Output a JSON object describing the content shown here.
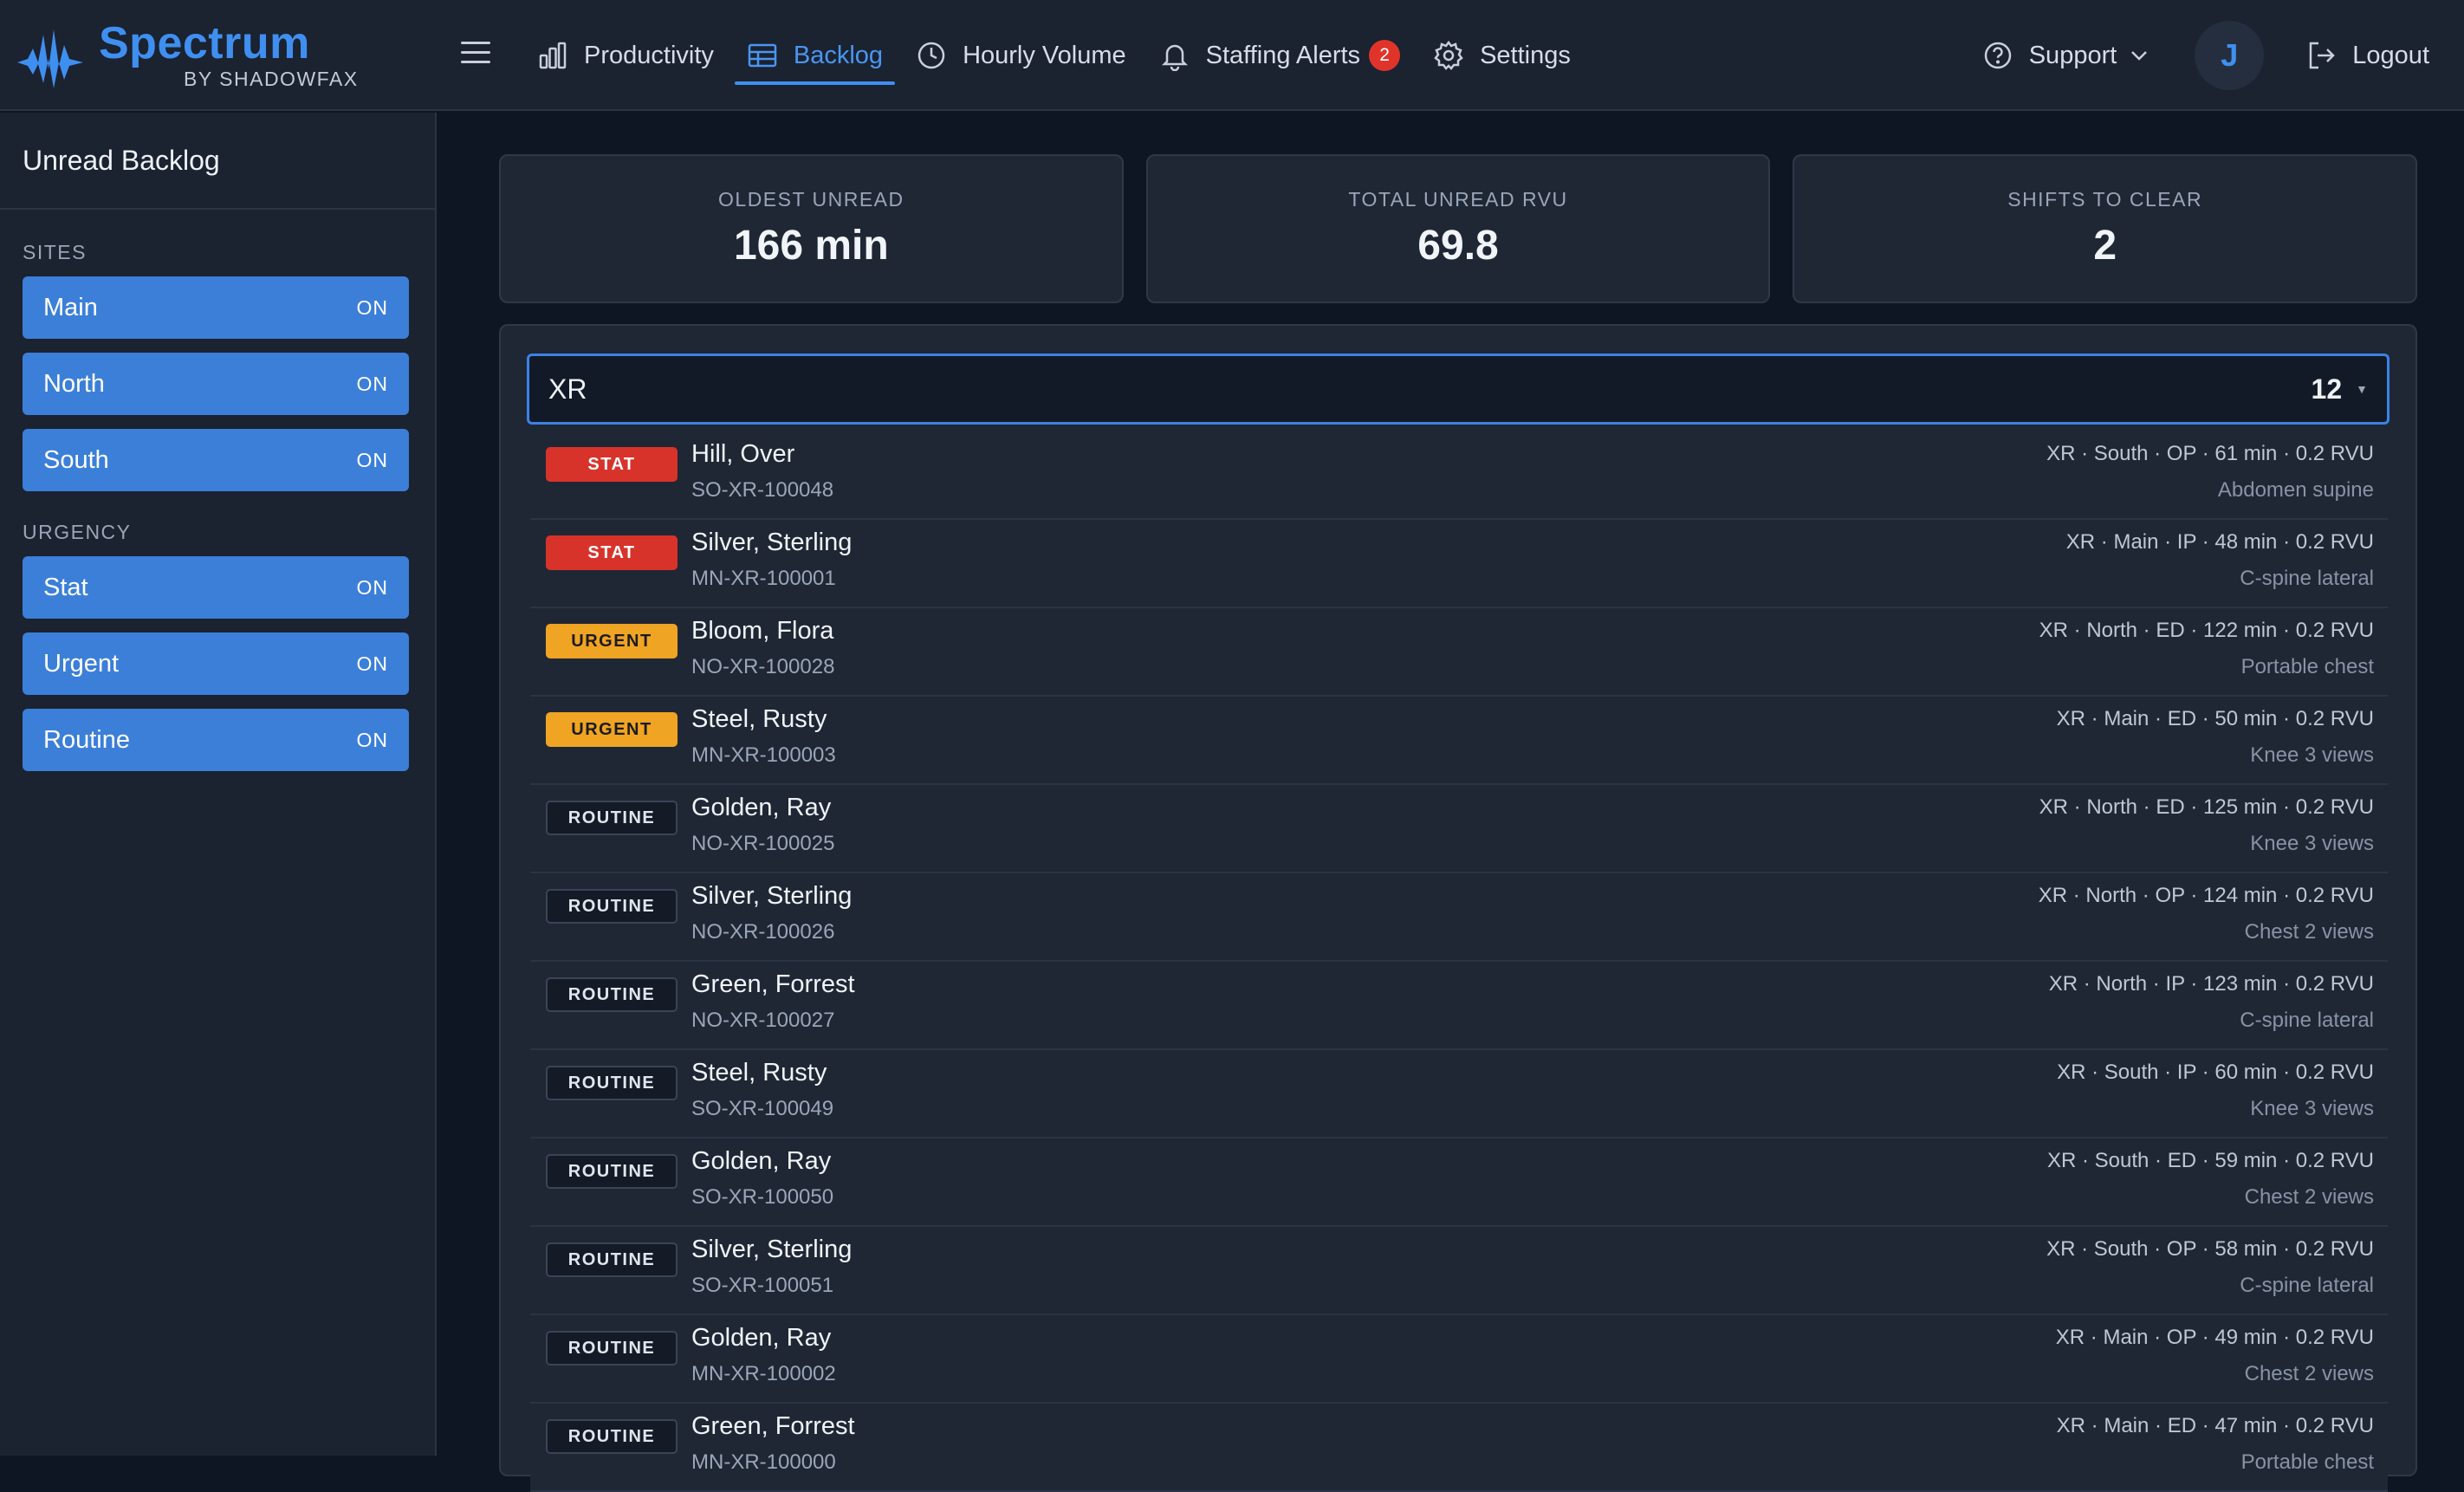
{
  "brand": {
    "name": "Spectrum",
    "sub": "BY SHADOWFAX"
  },
  "nav": [
    {
      "label": "Productivity",
      "icon": "bar-chart-icon",
      "active": false
    },
    {
      "label": "Backlog",
      "icon": "table-icon",
      "active": true
    },
    {
      "label": "Hourly Volume",
      "icon": "clock-icon",
      "active": false
    },
    {
      "label": "Staffing Alerts",
      "icon": "bell-icon",
      "active": false,
      "badge": "2"
    },
    {
      "label": "Settings",
      "icon": "gear-icon",
      "active": false
    }
  ],
  "header_right": {
    "support": "Support",
    "avatar": "J",
    "logout": "Logout"
  },
  "sidebar": {
    "title": "Unread Backlog",
    "sites_label": "SITES",
    "sites": [
      {
        "label": "Main",
        "state": "ON"
      },
      {
        "label": "North",
        "state": "ON"
      },
      {
        "label": "South",
        "state": "ON"
      }
    ],
    "urgency_label": "URGENCY",
    "urgency": [
      {
        "label": "Stat",
        "state": "ON"
      },
      {
        "label": "Urgent",
        "state": "ON"
      },
      {
        "label": "Routine",
        "state": "ON"
      }
    ]
  },
  "stats": [
    {
      "label": "OLDEST UNREAD",
      "value": "166 min"
    },
    {
      "label": "TOTAL UNREAD RVU",
      "value": "69.8"
    },
    {
      "label": "SHIFTS TO CLEAR",
      "value": "2"
    }
  ],
  "filter": {
    "modality": "XR",
    "count": "12"
  },
  "colors": {
    "accent": "#3f8ff0",
    "stat": "#d8332a",
    "urgent": "#f0a423",
    "badge": "#e0342b"
  },
  "rows": [
    {
      "priority": "STAT",
      "kind": "stat",
      "name": "Hill, Over",
      "id": "SO-XR-100048",
      "meta": "XR · South · OP · 61 min · 0.2 RVU",
      "desc": "Abdomen supine"
    },
    {
      "priority": "STAT",
      "kind": "stat",
      "name": "Silver, Sterling",
      "id": "MN-XR-100001",
      "meta": "XR · Main · IP · 48 min · 0.2 RVU",
      "desc": "C-spine lateral"
    },
    {
      "priority": "URGENT",
      "kind": "urgent",
      "name": "Bloom, Flora",
      "id": "NO-XR-100028",
      "meta": "XR · North · ED · 122 min · 0.2 RVU",
      "desc": "Portable chest"
    },
    {
      "priority": "URGENT",
      "kind": "urgent",
      "name": "Steel, Rusty",
      "id": "MN-XR-100003",
      "meta": "XR · Main · ED · 50 min · 0.2 RVU",
      "desc": "Knee 3 views"
    },
    {
      "priority": "ROUTINE",
      "kind": "routine",
      "name": "Golden, Ray",
      "id": "NO-XR-100025",
      "meta": "XR · North · ED · 125 min · 0.2 RVU",
      "desc": "Knee 3 views"
    },
    {
      "priority": "ROUTINE",
      "kind": "routine",
      "name": "Silver, Sterling",
      "id": "NO-XR-100026",
      "meta": "XR · North · OP · 124 min · 0.2 RVU",
      "desc": "Chest 2 views"
    },
    {
      "priority": "ROUTINE",
      "kind": "routine",
      "name": "Green, Forrest",
      "id": "NO-XR-100027",
      "meta": "XR · North · IP · 123 min · 0.2 RVU",
      "desc": "C-spine lateral"
    },
    {
      "priority": "ROUTINE",
      "kind": "routine",
      "name": "Steel, Rusty",
      "id": "SO-XR-100049",
      "meta": "XR · South · IP · 60 min · 0.2 RVU",
      "desc": "Knee 3 views"
    },
    {
      "priority": "ROUTINE",
      "kind": "routine",
      "name": "Golden, Ray",
      "id": "SO-XR-100050",
      "meta": "XR · South · ED · 59 min · 0.2 RVU",
      "desc": "Chest 2 views"
    },
    {
      "priority": "ROUTINE",
      "kind": "routine",
      "name": "Silver, Sterling",
      "id": "SO-XR-100051",
      "meta": "XR · South · OP · 58 min · 0.2 RVU",
      "desc": "C-spine lateral"
    },
    {
      "priority": "ROUTINE",
      "kind": "routine",
      "name": "Golden, Ray",
      "id": "MN-XR-100002",
      "meta": "XR · Main · OP · 49 min · 0.2 RVU",
      "desc": "Chest 2 views"
    },
    {
      "priority": "ROUTINE",
      "kind": "routine",
      "name": "Green, Forrest",
      "id": "MN-XR-100000",
      "meta": "XR · Main · ED · 47 min · 0.2 RVU",
      "desc": "Portable chest"
    }
  ]
}
